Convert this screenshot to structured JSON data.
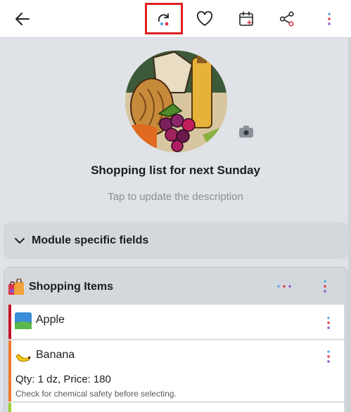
{
  "toolbar": {
    "icons": [
      "back-arrow-icon",
      "refresh-icon",
      "heart-icon",
      "calendar-add-icon",
      "share-icon",
      "more-vert-icon"
    ]
  },
  "list": {
    "title": "Shopping list for next Sunday",
    "description_placeholder": "Tap to update the description"
  },
  "module_section": {
    "label": "Module specific fields"
  },
  "items_section": {
    "label": "Shopping Items",
    "items": [
      {
        "name": "Apple",
        "bar_color": "#c4152a"
      },
      {
        "name": "Banana",
        "qty": "Qty: 1 dz, Price: 180",
        "note": "Check for chemical safety before selecting.",
        "bar_color": "#f07a2c"
      }
    ]
  },
  "colors": {
    "accent_blue": "#5aa8e8",
    "accent_red": "#e0344a",
    "highlight": "#e02020"
  }
}
